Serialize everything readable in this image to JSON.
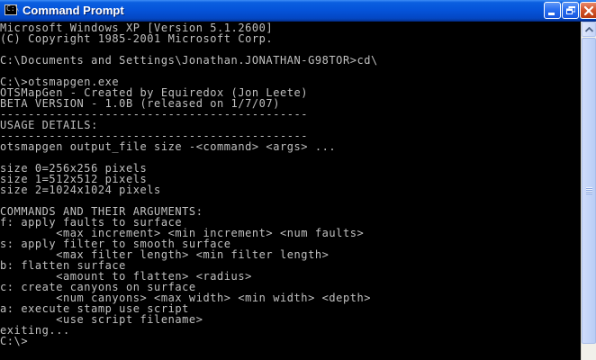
{
  "window": {
    "title": "Command Prompt",
    "icon_name": "cmd-icon",
    "icon_glyph": "C:\\",
    "colors": {
      "titlebar": "#0553d9",
      "console_background": "#000000",
      "console_text": "#c0c0c0",
      "close_button": "#d4552c"
    }
  },
  "title_buttons": {
    "minimize_icon": "minimize-icon",
    "maximize_icon": "restore-icon",
    "close_icon": "close-icon"
  },
  "console": {
    "lines": [
      "Microsoft Windows XP [Version 5.1.2600]",
      "(C) Copyright 1985-2001 Microsoft Corp.",
      "",
      "C:\\Documents and Settings\\Jonathan.JONATHAN-G98TOR>cd\\",
      "",
      "C:\\>otsmapgen.exe",
      "OTSMapGen - Created by Equiredox (Jon Leete)",
      "BETA VERSION - 1.0B (released on 1/7/07)",
      "--------------------------------------------",
      "USAGE DETAILS:",
      "--------------------------------------------",
      "otsmapgen output_file size -<command> <args> ...",
      "",
      "size 0=256x256 pixels",
      "size 1=512x512 pixels",
      "size 2=1024x1024 pixels",
      "",
      "COMMANDS AND THEIR ARGUMENTS:",
      "f: apply faults to surface",
      "        <max increment> <min increment> <num faults>",
      "s: apply filter to smooth surface",
      "        <max filter length> <min filter length>",
      "b: flatten surface",
      "        <amount to flatten> <radius>",
      "c: create canyons on surface",
      "        <num canyons> <max width> <min width> <depth>",
      "a: execute stamp use script",
      "        <use script filename>",
      "exiting...",
      "C:\\>"
    ]
  },
  "scrollbar": {
    "up_icon": "scroll-up-arrow-icon",
    "thumb_name": "scroll-thumb"
  }
}
